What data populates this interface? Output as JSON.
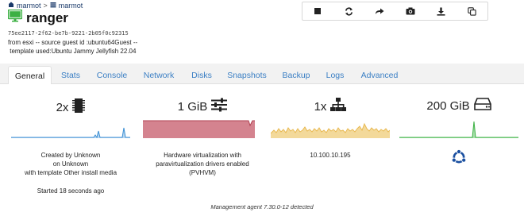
{
  "breadcrumb": {
    "pool": "marmot",
    "host": "marmot",
    "separator": ">"
  },
  "vm": {
    "name": "ranger",
    "uuid": "75ee2117-2f62-be7b-9221-2b05f0c92315",
    "description_line1": "from esxi -- source guest id :ubuntu64Guest --",
    "description_line2": " template used:Ubuntu Jammy Jellyfish 22.04"
  },
  "toolbar": {
    "buttons": [
      "stop-icon",
      "restart-icon",
      "migrate-icon",
      "snapshot-icon",
      "export-icon",
      "copy-icon"
    ]
  },
  "tabs": [
    {
      "label": "General",
      "active": true
    },
    {
      "label": "Stats"
    },
    {
      "label": "Console"
    },
    {
      "label": "Network"
    },
    {
      "label": "Disks"
    },
    {
      "label": "Snapshots"
    },
    {
      "label": "Backup"
    },
    {
      "label": "Logs"
    },
    {
      "label": "Advanced"
    }
  ],
  "stats": {
    "cpu": {
      "value": "2x",
      "icon": "cpu-chip-icon",
      "color": "#3b8fd4"
    },
    "memory": {
      "value": "1 GiB",
      "icon": "sliders-icon",
      "color": "#c96070"
    },
    "network": {
      "value": "1x",
      "icon": "network-icon",
      "color": "#e8b84f"
    },
    "disk": {
      "value": "200 GiB",
      "icon": "hdd-icon",
      "color": "#3cb043"
    }
  },
  "info": {
    "created_line1": "Created by Unknown",
    "created_line2": "on Unknown",
    "created_line3": "with template Other install media",
    "started": "Started 18 seconds ago",
    "virt_line1": "Hardware virtualization with",
    "virt_line2": "paravirtualization drivers enabled",
    "virt_line3": "(PVHVM)",
    "ip": "10.100.10.195",
    "os_icon": "ubuntu-icon"
  },
  "footer": {
    "agent": "Management agent 7.30.0-12 detected"
  }
}
